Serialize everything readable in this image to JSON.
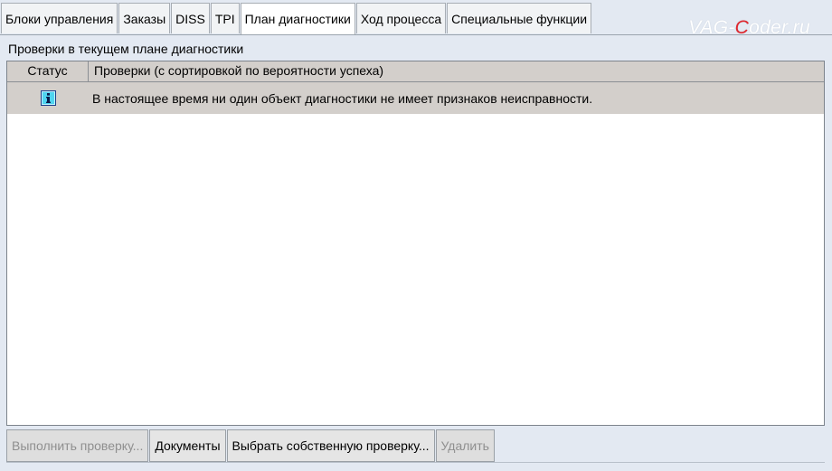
{
  "tabs": [
    {
      "label": "Блоки управления",
      "active": false
    },
    {
      "label": "Заказы",
      "active": false
    },
    {
      "label": "DISS",
      "active": false
    },
    {
      "label": "TPI",
      "active": false
    },
    {
      "label": "План диагностики",
      "active": true
    },
    {
      "label": "Ход процесса",
      "active": false
    },
    {
      "label": "Специальные функции",
      "active": false
    }
  ],
  "brand": {
    "prefix": "VAG-",
    "accent": "C",
    "suffix": "oder.ru",
    "accent_color": "#e0262d"
  },
  "section_label": "Проверки в текущем плане диагностики",
  "table": {
    "columns": [
      "Статус",
      "Проверки (с сортировкой по вероятности успеха)"
    ],
    "rows": [
      {
        "status_icon": "info-icon",
        "text": "В настоящее время ни один объект диагностики не имеет признаков неисправности."
      }
    ]
  },
  "buttons": [
    {
      "label": "Выполнить проверку...",
      "enabled": false
    },
    {
      "label": "Документы",
      "enabled": true
    },
    {
      "label": "Выбрать собственную проверку...",
      "enabled": true
    },
    {
      "label": "Удалить",
      "enabled": false
    }
  ]
}
